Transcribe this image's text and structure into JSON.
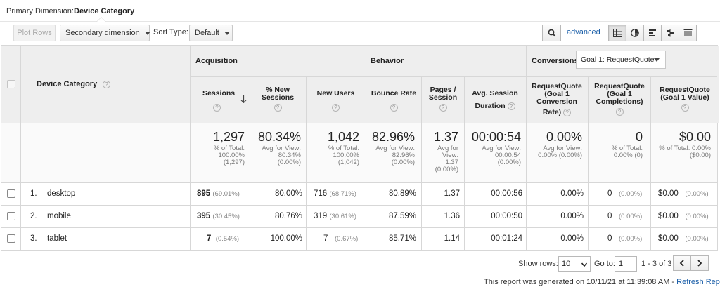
{
  "primary_dimension": {
    "label": "Primary Dimension:",
    "value": "Device Category"
  },
  "toolbar": {
    "plot_rows": "Plot Rows",
    "secondary_dimension": "Secondary dimension",
    "sort_type_label": "Sort Type:",
    "sort_type_value": "Default",
    "search_placeholder": "",
    "advanced": "advanced",
    "view_icons": [
      "table-view-icon",
      "pie-view-icon",
      "performance-view-icon",
      "comparison-view-icon",
      "pivot-view-icon"
    ]
  },
  "table": {
    "dimension_header": "Device Category",
    "groups": {
      "acquisition": "Acquisition",
      "behavior": "Behavior",
      "conversions": "Conversions"
    },
    "goal_select": "Goal 1: RequestQuote",
    "columns": {
      "sessions": "Sessions",
      "new_sessions_1": "% New",
      "new_sessions_2": "Sessions",
      "new_users": "New Users",
      "bounce_rate": "Bounce Rate",
      "pages_1": "Pages /",
      "pages_2": "Session",
      "avg_dur_1": "Avg. Session",
      "avg_dur_2": "Duration",
      "conv_rate_1": "RequestQuote",
      "conv_rate_2": "(Goal 1",
      "conv_rate_3": "Conversion",
      "conv_rate_4": "Rate)",
      "completions_1": "RequestQuote",
      "completions_2": "(Goal 1",
      "completions_3": "Completions)",
      "value_1": "RequestQuote",
      "value_2": "(Goal 1 Value)"
    },
    "totals": {
      "sessions": {
        "main": "1,297",
        "sub1": "% of Total:",
        "sub2": "100.00%",
        "sub3": "(1,297)"
      },
      "new_sessions": {
        "main": "80.34%",
        "sub1": "Avg for View:",
        "sub2": "80.34%",
        "sub3": "(0.00%)"
      },
      "new_users": {
        "main": "1,042",
        "sub1": "% of Total:",
        "sub2": "100.00%",
        "sub3": "(1,042)"
      },
      "bounce_rate": {
        "main": "82.96%",
        "sub1": "Avg for View:",
        "sub2": "82.96%",
        "sub3": "(0.00%)"
      },
      "pages": {
        "main": "1.37",
        "sub1": "Avg for",
        "sub2": "View:",
        "sub3": "1.37",
        "sub4": "(0.00%)"
      },
      "avg_duration": {
        "main": "00:00:54",
        "sub1": "Avg for View:",
        "sub2": "00:00:54",
        "sub3": "(0.00%)"
      },
      "conv_rate": {
        "main": "0.00%",
        "sub1": "Avg for View:",
        "sub2": "0.00% (0.00%)"
      },
      "completions": {
        "main": "0",
        "sub1": "% of Total:",
        "sub2": "0.00% (0)"
      },
      "value": {
        "main": "$0.00",
        "sub1": "% of Total: 0.00%",
        "sub2": "($0.00)"
      }
    },
    "rows": [
      {
        "index": "1.",
        "name": "desktop",
        "sessions": "895",
        "sessions_pct": "(69.01%)",
        "new_sessions": "80.00%",
        "new_users": "716",
        "new_users_pct": "(68.71%)",
        "bounce_rate": "80.89%",
        "pages": "1.37",
        "duration": "00:00:56",
        "conv_rate": "0.00%",
        "completions": "0",
        "completions_pct": "(0.00%)",
        "value": "$0.00",
        "value_pct": "(0.00%)"
      },
      {
        "index": "2.",
        "name": "mobile",
        "sessions": "395",
        "sessions_pct": "(30.45%)",
        "new_sessions": "80.76%",
        "new_users": "319",
        "new_users_pct": "(30.61%)",
        "bounce_rate": "87.59%",
        "pages": "1.36",
        "duration": "00:00:50",
        "conv_rate": "0.00%",
        "completions": "0",
        "completions_pct": "(0.00%)",
        "value": "$0.00",
        "value_pct": "(0.00%)"
      },
      {
        "index": "3.",
        "name": "tablet",
        "sessions": "7",
        "sessions_pct": "(0.54%)",
        "new_sessions": "100.00%",
        "new_users": "7",
        "new_users_pct": "(0.67%)",
        "bounce_rate": "85.71%",
        "pages": "1.14",
        "duration": "00:01:24",
        "conv_rate": "0.00%",
        "completions": "0",
        "completions_pct": "(0.00%)",
        "value": "$0.00",
        "value_pct": "(0.00%)"
      }
    ]
  },
  "footer": {
    "show_rows_label": "Show rows:",
    "show_rows_value": "10",
    "goto_label": "Go to:",
    "goto_value": "1",
    "range": "1 - 3 of 3",
    "report_note": "This report was generated on 10/11/21 at 11:39:08 AM - ",
    "refresh": "Refresh Report"
  },
  "colors": {
    "link": "#1a5ea8",
    "header_bg": "#eeeeee",
    "border": "#d7d7d7"
  }
}
